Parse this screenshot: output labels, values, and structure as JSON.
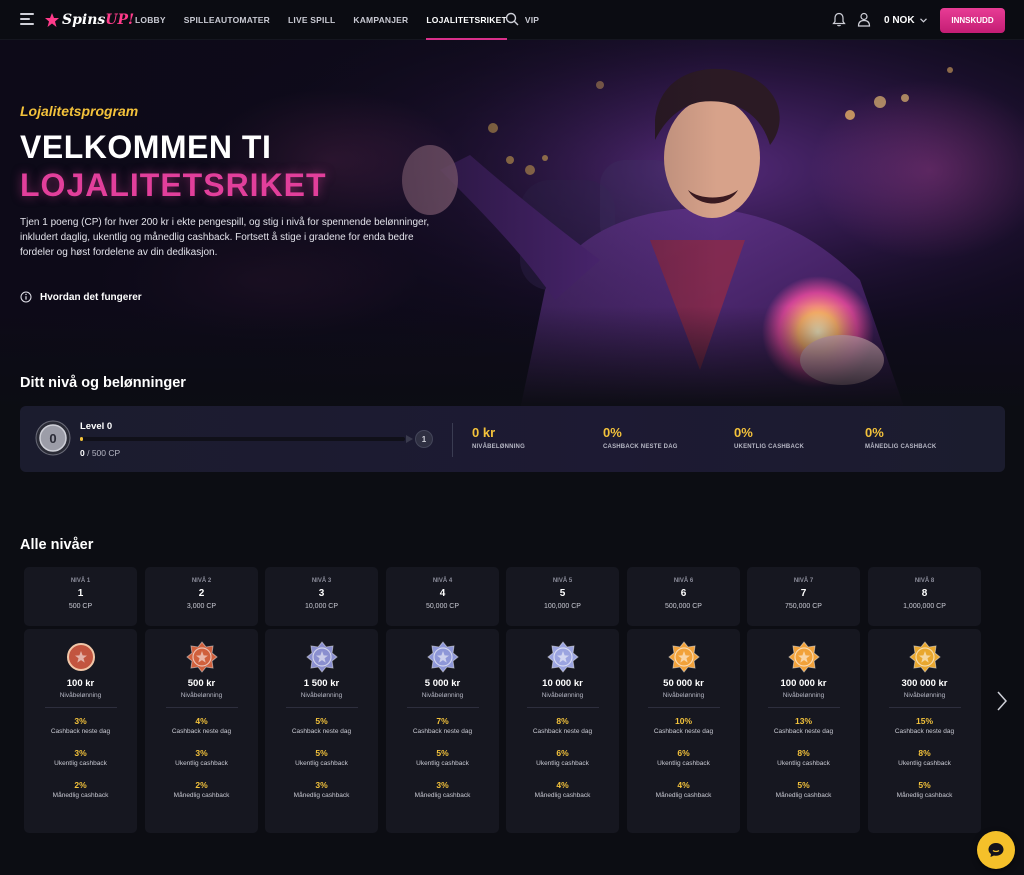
{
  "header": {
    "logo_text": "Spins",
    "logo_up": "UP!",
    "nav": [
      "LOBBY",
      "SPILLEAUTOMATER",
      "LIVE SPILL",
      "KAMPANJER",
      "LOJALITETSRIKET",
      "VIP"
    ],
    "active_nav": "LOJALITETSRIKET",
    "balance": "0 NOK",
    "deposit_label": "INNSKUDD",
    "icons": [
      "menu-icon",
      "search-icon",
      "bell-icon",
      "user-icon",
      "chevron-down-icon"
    ]
  },
  "hero": {
    "kicker": "Lojalitetsprogram",
    "title_line1": "VELKOMMEN TI",
    "title_line2": "LOJALITETSRIKET",
    "description": "Tjen 1 poeng (CP) for hver 200 kr i ekte pengespill, og stig i nivå for spennende belønninger, inkludert daglig, ukentlig og månedlig cashback. Fortsett å stige i gradene for enda bedre fordeler og høst fordelene av din dedikasjon.",
    "how_link": "Hvordan det fungerer"
  },
  "rewards": {
    "section_title": "Ditt nivå og belønninger",
    "level_name": "Level 0",
    "coin_label": "0",
    "progress_current": "0",
    "progress_total": "/ 500 CP",
    "progress_fraction": 0.01,
    "next_level": "1",
    "stats": [
      {
        "value": "0 kr",
        "label": "NIVÅBELØNNING"
      },
      {
        "value": "0%",
        "label": "CASHBACK NESTE DAG"
      },
      {
        "value": "0%",
        "label": "UKENTLIG CASHBACK"
      },
      {
        "value": "0%",
        "label": "MÅNEDLIG CASHBACK"
      }
    ]
  },
  "levels": {
    "section_title": "Alle nivåer",
    "reward_label": "Nivåbelønning",
    "cashback_next_day_label": "Cashback neste dag",
    "weekly_label": "Ukentlig cashback",
    "monthly_label": "Månedlig cashback",
    "items": [
      {
        "tag": "NIVÅ 1",
        "num": "1",
        "cp": "500 CP",
        "reward": "100 kr",
        "next_day": "3%",
        "weekly": "3%",
        "monthly": "2%",
        "color": "#c2553f"
      },
      {
        "tag": "NIVÅ 2",
        "num": "2",
        "cp": "3,000 CP",
        "reward": "500 kr",
        "next_day": "4%",
        "weekly": "3%",
        "monthly": "2%",
        "color": "#d0603c"
      },
      {
        "tag": "NIVÅ 3",
        "num": "3",
        "cp": "10,000 CP",
        "reward": "1 500 kr",
        "next_day": "5%",
        "weekly": "5%",
        "monthly": "3%",
        "color": "#8a8fcf"
      },
      {
        "tag": "NIVÅ 4",
        "num": "4",
        "cp": "50,000 CP",
        "reward": "5 000 kr",
        "next_day": "7%",
        "weekly": "5%",
        "monthly": "3%",
        "color": "#8e97d8"
      },
      {
        "tag": "NIVÅ 5",
        "num": "5",
        "cp": "100,000 CP",
        "reward": "10 000 kr",
        "next_day": "8%",
        "weekly": "6%",
        "monthly": "4%",
        "color": "#9ba4e0"
      },
      {
        "tag": "NIVÅ 6",
        "num": "6",
        "cp": "500,000 CP",
        "reward": "50 000 kr",
        "next_day": "10%",
        "weekly": "6%",
        "monthly": "4%",
        "color": "#f2a23a"
      },
      {
        "tag": "NIVÅ 7",
        "num": "7",
        "cp": "750,000 CP",
        "reward": "100 000 kr",
        "next_day": "13%",
        "weekly": "8%",
        "monthly": "5%",
        "color": "#f2a23a"
      },
      {
        "tag": "NIVÅ 8",
        "num": "8",
        "cp": "1,000,000 CP",
        "reward": "300 000 kr",
        "next_day": "15%",
        "weekly": "8%",
        "monthly": "5%",
        "color": "#e9a72e"
      }
    ]
  },
  "colors": {
    "accent_pink": "#d9308a",
    "accent_gold": "#f3c23b",
    "background": "#0c0d13",
    "card": "#161720"
  }
}
